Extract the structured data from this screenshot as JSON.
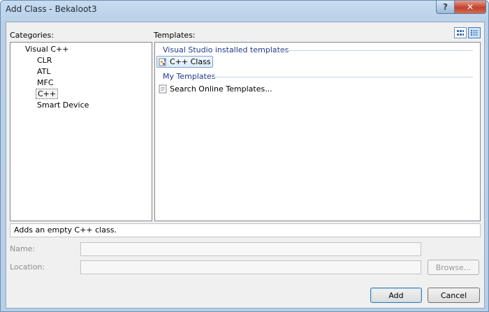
{
  "window": {
    "title": "Add Class - Bekaloot3",
    "help_label": "?",
    "close_label": "✕"
  },
  "categories": {
    "label": "Categories:",
    "items": [
      {
        "label": "Visual C++"
      },
      {
        "label": "CLR"
      },
      {
        "label": "ATL"
      },
      {
        "label": "MFC"
      },
      {
        "label": "C++"
      },
      {
        "label": "Smart Device"
      }
    ],
    "selected": "C++"
  },
  "templates": {
    "label": "Templates:",
    "groups": [
      {
        "heading": "Visual Studio installed templates",
        "items": [
          {
            "label": "C++ Class",
            "icon": "cpp-class-icon"
          }
        ]
      },
      {
        "heading": "My Templates",
        "items": [
          {
            "label": "Search Online Templates...",
            "icon": "search-online-icon"
          }
        ]
      }
    ],
    "selected": "C++ Class"
  },
  "description": "Adds an empty C++ class.",
  "form": {
    "name_label": "Name:",
    "name_value": "",
    "location_label": "Location:",
    "location_value": "",
    "browse_label": "Browse..."
  },
  "buttons": {
    "add_label": "Add",
    "cancel_label": "Cancel"
  }
}
